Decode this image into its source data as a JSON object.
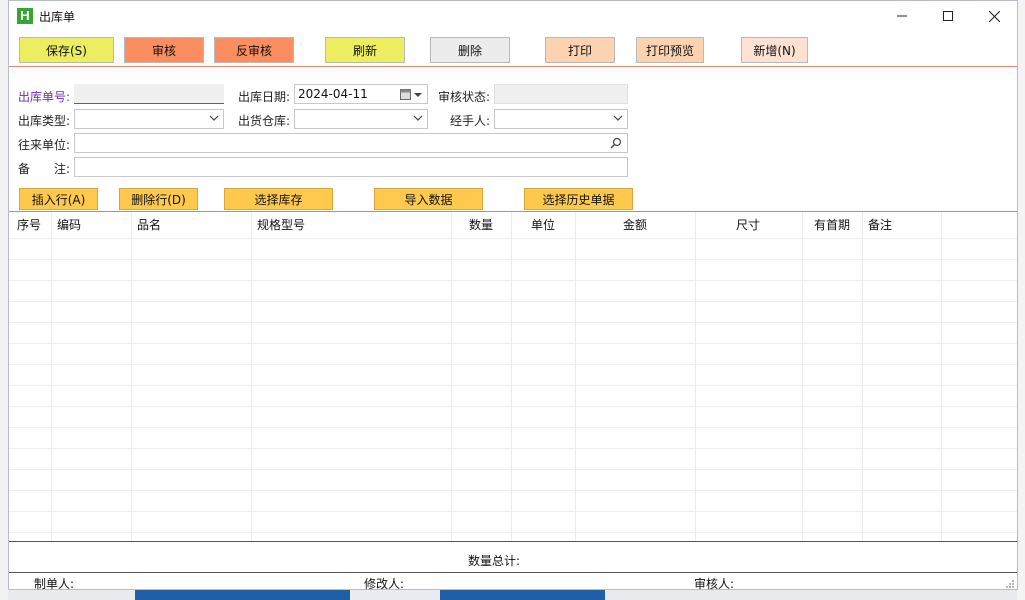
{
  "window": {
    "title": "出库单",
    "app_icon_letter": "H"
  },
  "toolbar": {
    "save": "保存(S)",
    "audit": "审核",
    "unaudit": "反审核",
    "refresh": "刷新",
    "delete": "删除",
    "print": "打印",
    "print_preview": "打印预览",
    "new": "新增(N)"
  },
  "form": {
    "order_no_label": "出库单号:",
    "order_no_value": "",
    "out_date_label": "出库日期:",
    "out_date_value": "2024-04-11",
    "audit_status_label": "审核状态:",
    "audit_status_value": "",
    "out_type_label": "出库类型:",
    "out_type_value": "",
    "warehouse_label": "出货仓库:",
    "warehouse_value": "",
    "handler_label": "经手人:",
    "handler_value": "",
    "partner_label": "往来单位:",
    "partner_value": "",
    "remark_label": "备　　注:",
    "remark_value": ""
  },
  "actions": {
    "insert_row": "插入行(A)",
    "delete_row": "删除行(D)",
    "select_stock": "选择库存",
    "import_data": "导入数据",
    "select_history": "选择历史单据"
  },
  "grid": {
    "columns": [
      "序号",
      "编码",
      "品名",
      "规格型号",
      "数量",
      "单位",
      "金额",
      "尺寸",
      "有首期",
      "备注"
    ],
    "rows": []
  },
  "footer": {
    "total_qty_label": "数量总计:",
    "maker_label": "制单人:",
    "modifier_label": "修改人:",
    "auditor_label": "审核人:"
  },
  "colors": {
    "save_bg": "#eded62",
    "audit_bg": "#fb8e60",
    "refresh_bg": "#eded62",
    "delete_bg": "#ececec",
    "print_bg": "#fcd3b0",
    "new_bg": "#fde2d4",
    "action_bg": "#ffc94e"
  }
}
